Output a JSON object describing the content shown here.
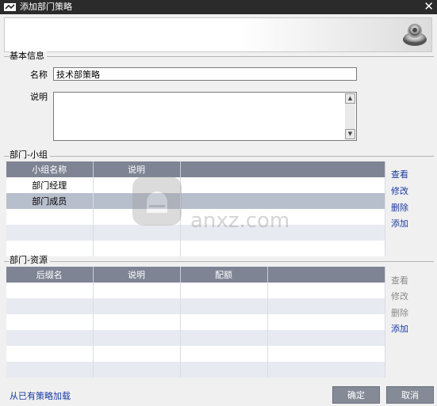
{
  "window": {
    "title": "添加部门策略",
    "close_glyph": "✕"
  },
  "basic": {
    "group_label": "基本信息",
    "name_label": "名称",
    "name_value": "技术部策略",
    "desc_label": "说明",
    "desc_value": ""
  },
  "groups": {
    "group_label": "部门-小组",
    "columns": [
      "小组名称",
      "说明",
      ""
    ],
    "rows": [
      [
        "部门经理",
        "",
        ""
      ],
      [
        "部门成员",
        "",
        ""
      ],
      [
        "",
        "",
        ""
      ],
      [
        "",
        "",
        ""
      ],
      [
        "",
        "",
        ""
      ]
    ],
    "actions": {
      "view": "查看",
      "edit": "修改",
      "delete": "删除",
      "add": "添加"
    }
  },
  "resources": {
    "group_label": "部门-资源",
    "columns": [
      "后缀名",
      "说明",
      "配额",
      ""
    ],
    "rows": [
      [
        "",
        "",
        "",
        ""
      ],
      [
        "",
        "",
        "",
        ""
      ],
      [
        "",
        "",
        "",
        ""
      ],
      [
        "",
        "",
        "",
        ""
      ],
      [
        "",
        "",
        "",
        ""
      ],
      [
        "",
        "",
        "",
        ""
      ]
    ],
    "actions": {
      "view": "查看",
      "edit": "修改",
      "delete": "删除",
      "add": "添加"
    }
  },
  "footer": {
    "load_link": "从已有策略加载",
    "ok_button": "确定",
    "cancel_button": "取消"
  },
  "watermark": {
    "text": "anxz.com"
  },
  "colors": {
    "title_bg": "#2b2b2b",
    "header_bg": "#7e8494",
    "link": "#1a3aa0",
    "button_bg": "#848a96"
  }
}
